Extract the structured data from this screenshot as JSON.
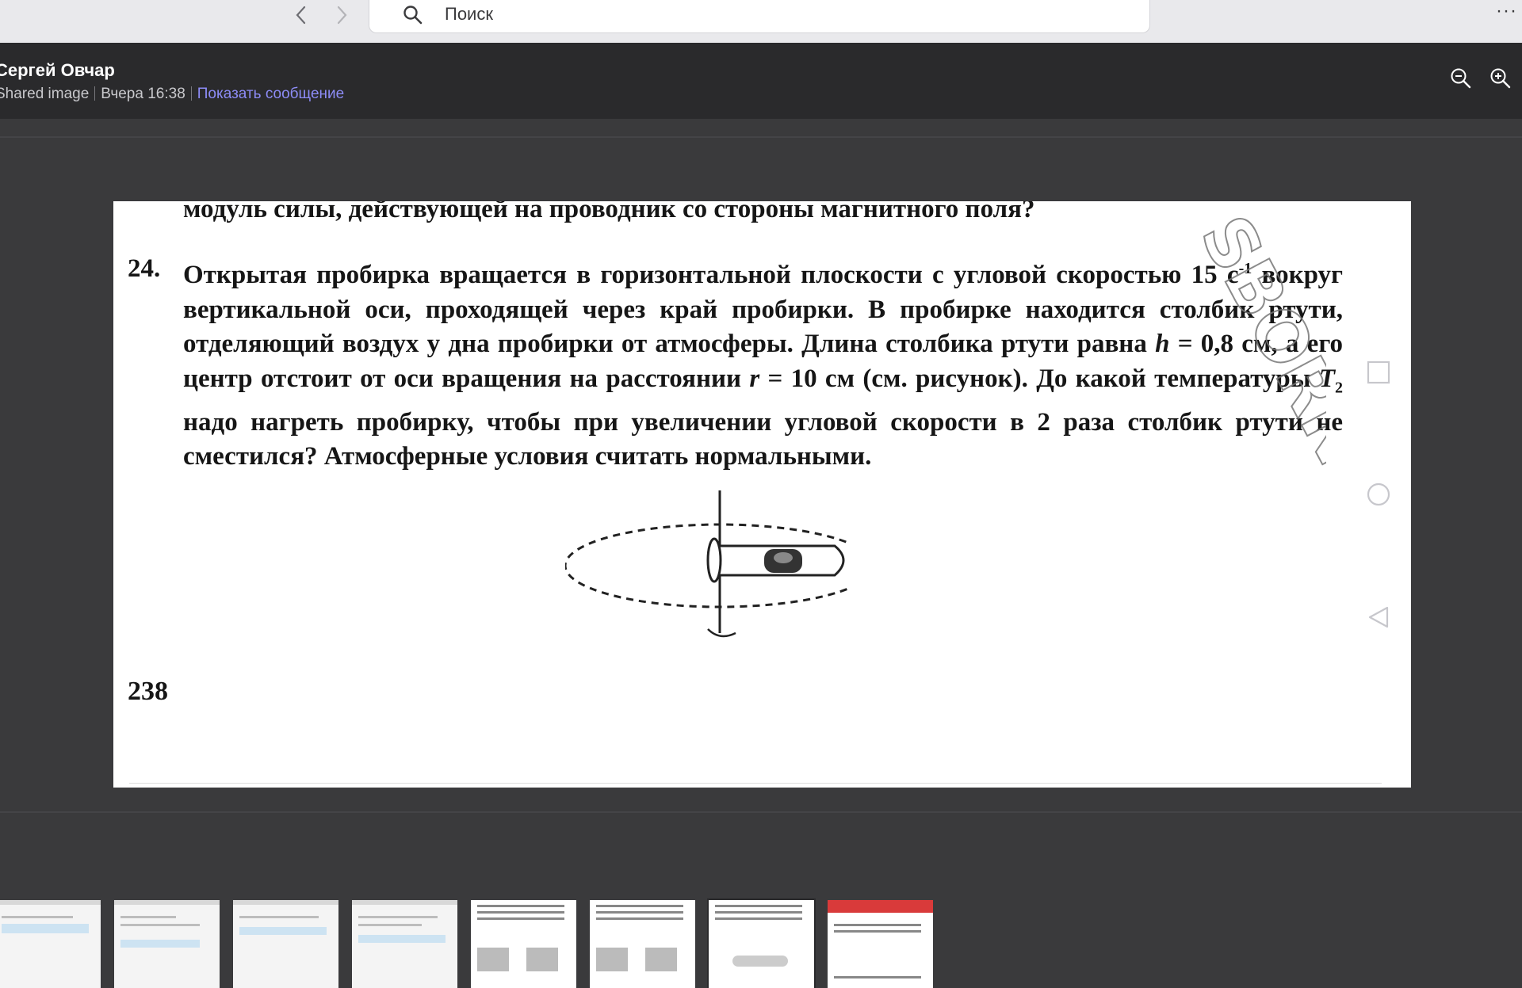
{
  "toolbar": {
    "search_placeholder": "Поиск",
    "more_label": "···"
  },
  "header": {
    "sender_name": "Сергей Овчар",
    "shared_label": "Shared image",
    "timestamp": "Вчера 16:38",
    "show_message_link": "Показать сообщение"
  },
  "document": {
    "prev_line": "модуль силы, действующей на проводник со стороны магнитного поля?",
    "question_number": "24.",
    "text_part1": "Открытая пробирка вращается в горизонтальной плоскости с угловой скоростью 15 с",
    "superscript": "-1",
    "text_part2": " вокруг вертикальной оси, проходящей через край пробирки. В пробирке находится столбик ртути, отделяющий воздух у дна пробирки от атмосферы. Длина столбика ртути равна ",
    "var_h": "h",
    "text_part3": " = 0,8 см, а его центр отстоит от оси вращения на расстоянии ",
    "var_r": "r",
    "text_part4": " = 10 см (см. рисунок). До какой температуры ",
    "var_T": "T",
    "subscript": "2",
    "text_part5": " надо нагреть пробирку, чтобы при увеличении угловой скорости в 2 раза столбик ртути не сместился? Атмосферные условия считать нормальными.",
    "page_number": "238",
    "watermark": "SBORNIK.ME"
  },
  "icons": {
    "back": "chevron-left-icon",
    "forward": "chevron-right-icon",
    "search": "search-icon",
    "zoom_out": "zoom-out-icon",
    "zoom_in": "zoom-in-icon",
    "square": "square-icon",
    "circle": "circle-icon",
    "triangle": "triangle-back-icon"
  }
}
